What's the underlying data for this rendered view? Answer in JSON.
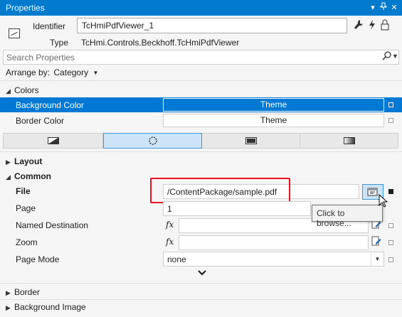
{
  "window": {
    "title": "Properties",
    "controls": [
      "dropdown-icon",
      "pin-icon",
      "close-icon"
    ]
  },
  "header": {
    "identifier_label": "Identifier",
    "identifier_value": "TcHmiPdfViewer_1",
    "type_label": "Type",
    "type_value": "TcHmi.Controls.Beckhoff.TcHmiPdfViewer",
    "tools": [
      "wrench-icon",
      "lightning-icon",
      "lock-icon"
    ]
  },
  "search": {
    "placeholder": "Search Properties"
  },
  "arrange": {
    "label": "Arrange by:",
    "value": "Category"
  },
  "colors": {
    "category": "Colors",
    "rows": [
      {
        "name": "Background Color",
        "value": "Theme",
        "selected": true
      },
      {
        "name": "Border Color",
        "value": "Theme",
        "selected": false
      }
    ]
  },
  "tabs": [
    "solid-fill-icon",
    "settings-icon",
    "filled-rectangle-icon",
    "gradient-icon"
  ],
  "categories": {
    "layout": "Layout",
    "common": "Common",
    "border": "Border",
    "background_image": "Background Image"
  },
  "common_props": {
    "file": {
      "name": "File",
      "value": "/ContentPackage/sample.pdf"
    },
    "page": {
      "name": "Page",
      "value": "1"
    },
    "named_destination": {
      "name": "Named Destination"
    },
    "zoom": {
      "name": "Zoom"
    },
    "page_mode": {
      "name": "Page Mode",
      "value": "none"
    }
  },
  "fx_label": "fx",
  "tooltip": "Click to browse...",
  "colors_accent": {
    "titlebar": "#007acc",
    "selection": "#0078d4",
    "highlight_box": "#e81123"
  }
}
